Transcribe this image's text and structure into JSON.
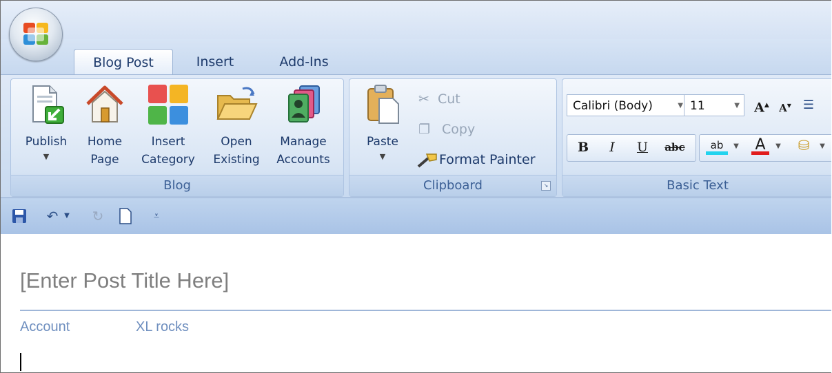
{
  "tabs": [
    "Blog Post",
    "Insert",
    "Add-Ins"
  ],
  "blog_group": {
    "label": "Blog",
    "buttons": [
      {
        "line1": "Publish",
        "line2": "",
        "has_dropdown": true,
        "icon": "publish-icon"
      },
      {
        "line1": "Home",
        "line2": "Page",
        "icon": "home-page-icon"
      },
      {
        "line1": "Insert",
        "line2": "Category",
        "icon": "insert-category-icon"
      },
      {
        "line1": "Open",
        "line2": "Existing",
        "icon": "open-folder-icon"
      },
      {
        "line1": "Manage",
        "line2": "Accounts",
        "icon": "manage-accounts-icon"
      }
    ]
  },
  "clipboard_group": {
    "label": "Clipboard",
    "paste": "Paste",
    "cut": "Cut",
    "copy": "Copy",
    "format_painter": "Format Painter"
  },
  "basic_text_group": {
    "label": "Basic Text",
    "font_name": "Calibri (Body)",
    "font_size": "11",
    "grow_font": "A",
    "shrink_font": "A",
    "bold": "B",
    "italic": "I",
    "underline": "U",
    "strikethrough": "abc",
    "highlight": "ab",
    "font_color": "A"
  },
  "colors": {
    "highlight_bar": "#22d3ee",
    "font_color_bar": "#e11d1d"
  },
  "document": {
    "title_placeholder": "[Enter Post Title Here]",
    "account_label": "Account",
    "account_value": "XL rocks"
  }
}
